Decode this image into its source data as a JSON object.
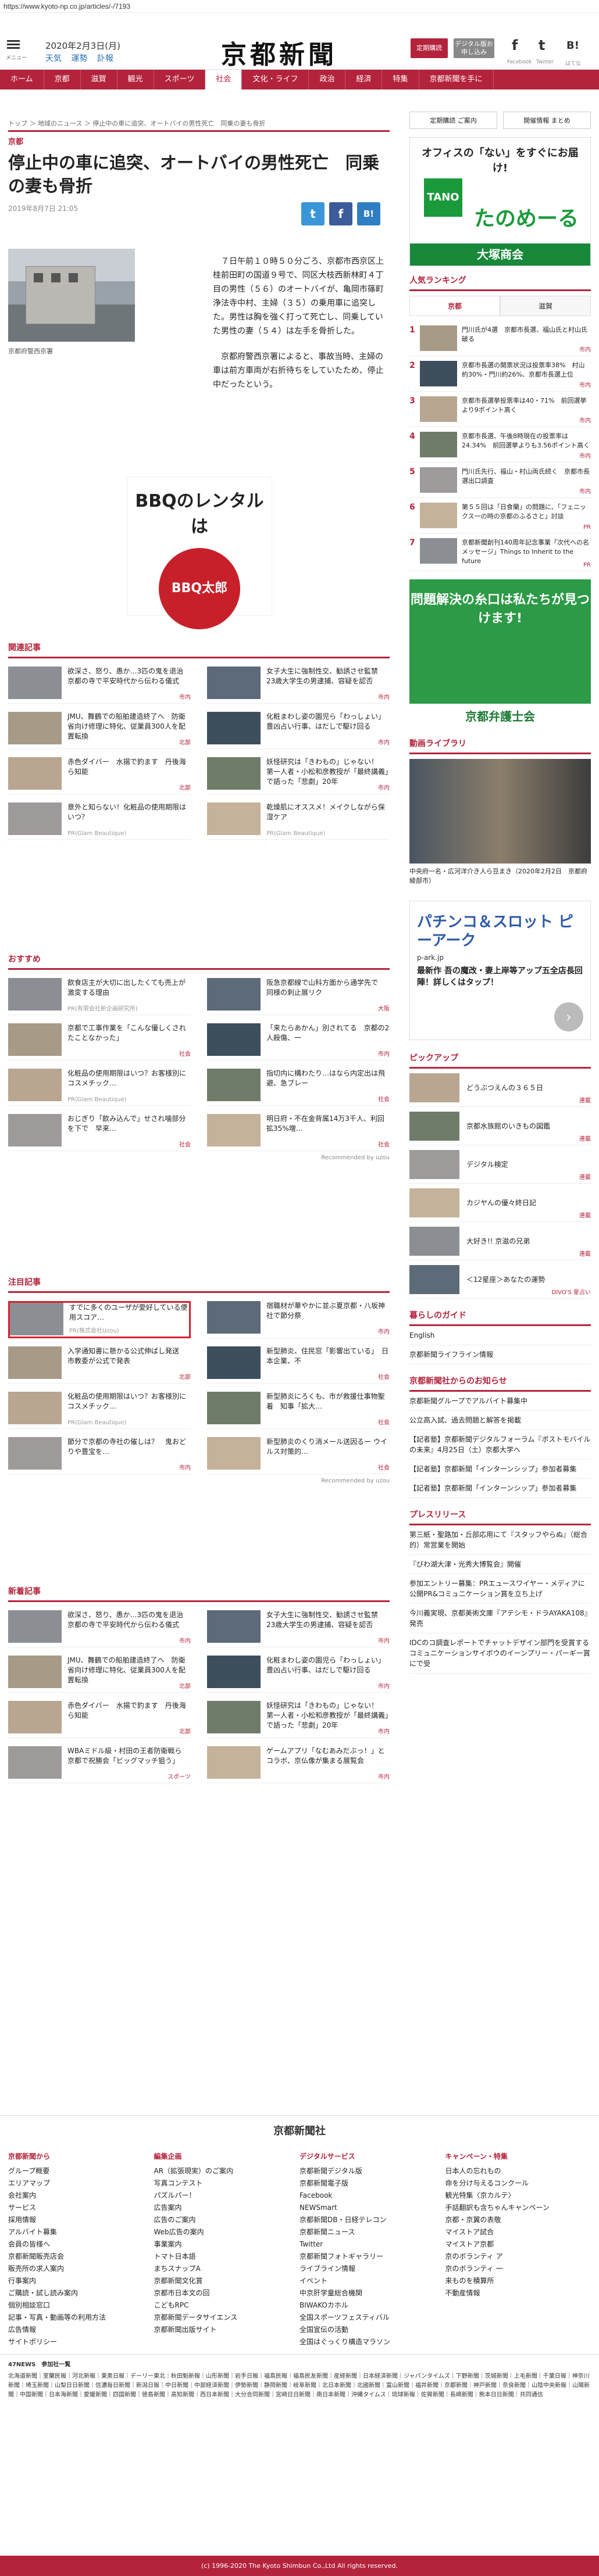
{
  "url": "https://www.kyoto-np.co.jp/articles/-/7193",
  "header": {
    "menu_label": "メニュー",
    "date": "2020年2月3日(月)",
    "weather": [
      "天気",
      "運勢",
      "訃報"
    ],
    "logo": "京都新聞",
    "subscribe_btn": "定期購読",
    "digital_btn": "デジタル版お申し込み",
    "social": [
      {
        "name": "facebook-icon",
        "glyph": "f",
        "label": "Facebook"
      },
      {
        "name": "twitter-icon",
        "glyph": "t",
        "label": "Twitter"
      },
      {
        "name": "hatena-icon",
        "glyph": "B!",
        "label": "はてな"
      }
    ]
  },
  "nav": [
    "ホーム",
    "京都",
    "滋賀",
    "観光",
    "スポーツ",
    "社会",
    "文化・ライフ",
    "政治",
    "経済",
    "特集",
    "京都新聞を手に"
  ],
  "nav_active": 5,
  "breadcrumb": "トップ ＞ 地域のニュース ＞ 停止中の車に追突、オートバイの男性死亡　同乗の妻も骨折",
  "article": {
    "section": "京都",
    "title": "停止中の車に追突、オートバイの男性死亡　同乗の妻も骨折",
    "date": "2019年8月7日 21:05",
    "caption": "京都府警西京署",
    "body": [
      "７日午前１０時５０分ごろ、京都市西京区上桂前田町の国道９号で、同区大枝西新林町４丁目の男性（５６）のオートバイが、亀岡市篠町浄法寺中村、主婦（３５）の乗用車に追突した。男性は胸を強く打って死亡し、同乗していた男性の妻（５４）は左手を骨折した。",
      "京都府警西京署によると、事故当時、主婦の車は前方車両が右折待ちをしていたため、停止中だったという。"
    ]
  },
  "ad_bbq": {
    "title": "BBQのレンタルは",
    "brand": "BBQ太郎"
  },
  "sections": {
    "related": {
      "title": "関連記事",
      "items": [
        {
          "text": "欲深さ、怒り、愚か…3匹の鬼を退治　京都の寺で平安時代から伝わる儀式",
          "tag": "市内"
        },
        {
          "text": "女子大生に強制性交、勧誘させ監禁　23歳大学生の男逮捕、容疑を認否",
          "tag": "市内"
        },
        {
          "text": "JMU、舞鶴での船舶建造終了へ　防衛省向け修理に特化、従業員300人を配置転換",
          "tag": "北部"
        },
        {
          "text": "化粧まわし姿の園児ら「わっしょい」　豊凶占い行事、はだしで駆け回る",
          "tag": "市内"
        },
        {
          "text": "赤色ダイバー　水揚で釣ます　丹後海ら知能",
          "tag": "北部"
        },
        {
          "text": "妖怪研究は「きわもの」じゃない！　第一人者・小松和彦教授が「最終講義」で語った「悲劇」20年",
          "tag": "市内"
        },
        {
          "text": "意外と知らない！化粧品の使用期限はいつ？",
          "pr": "PR(Glam Beautique)"
        },
        {
          "text": "乾燥肌にオススメ！メイクしながら保湿ケア",
          "pr": "PR(Glam Beautique)"
        }
      ]
    },
    "recommend": {
      "title": "おすすめ",
      "items": [
        {
          "text": "飲食店主が大切に出したくても売上が激変する理由",
          "pr": "PR(有限会社新企画研究所)"
        },
        {
          "text": "阪急京都線で山科方面から通学先で　同様の刺止展リク",
          "tag": "大阪"
        },
        {
          "text": "京都で工事作業を「こんな優しくされたことなかった」",
          "tag": "社会"
        },
        {
          "text": "「来たらあかん」別されてる　京都の2人殺傷、一",
          "tag": "市内"
        },
        {
          "text": "化粧品の使用期限はいつ？お客様別にコスメチック…",
          "pr": "PR(Glam Beautique)"
        },
        {
          "text": "指切内に構わたり…はなら内定出は飛避、急ブレー",
          "tag": "社会"
        },
        {
          "text": "おじぎり「飲み込んで」せされ噛部分を下で　早来…",
          "tag": "社会"
        },
        {
          "text": "明日府・不在金背属14万3千人、利回拡35%増…",
          "tag": "社会"
        }
      ],
      "credit": "Recommended by uzou"
    },
    "attention": {
      "title": "注目記事",
      "items": [
        {
          "text": "すでに多くのユーザが愛好している便用スコア…",
          "pr": "PR(株式会社Uzou)"
        },
        {
          "text": "宿職材が華やかに並ぶ夏京都・八坂神社で節分祭",
          "tag": "市内"
        },
        {
          "text": "入学通知書に懸かる公式伸ばし発送　市教委が公式で発表",
          "tag": "北部"
        },
        {
          "text": "新型肺炎、住民窓「影響出ている」　日本企業、不",
          "tag": "社会"
        },
        {
          "text": "化粧品の使用期限はいつ？お客様別にコスメチック…",
          "pr": "PR(Glam Beautique)"
        },
        {
          "text": "新型肺炎にろくも、市が救援仕事物聖着　知事「拡大…",
          "tag": "社会"
        },
        {
          "text": "節分で京都の寺社の催しは？　鬼おどりや豊宝を…",
          "tag": "市内"
        },
        {
          "text": "新型肺炎のくり消メール送因るー ウイルス対策的…",
          "tag": "社会"
        }
      ],
      "credit": "Recommended by uzou"
    },
    "latest": {
      "title": "新着記事",
      "items": [
        {
          "text": "欲深さ、怒り、愚か…3匹の鬼を退治　京都の寺で平安時代から伝わる儀式",
          "tag": "市内"
        },
        {
          "text": "女子大生に強制性交、勧誘させ監禁　23歳大学生の男逮捕、容疑を認否",
          "tag": "市内"
        },
        {
          "text": "JMU、舞鶴での船舶建造終了へ　防衛省向け修理に特化、従業員300人を配置転換",
          "tag": "北部"
        },
        {
          "text": "化粧まわし姿の園児ら「わっしょい」　豊凶占い行事、はだしで駆け回る",
          "tag": "市内"
        },
        {
          "text": "赤色ダイバー　水揚で釣ます　丹後海ら知能",
          "tag": "北部"
        },
        {
          "text": "妖怪研究は「きわもの」じゃない！　第一人者・小松和彦教授が「最終講義」で語った「悲劇」20年",
          "tag": "市内"
        },
        {
          "text": "WBAミドル級・村田の王者防衛戦ら　京都で祝勝会「ビッグマッチ狙う」",
          "tag": "スポーツ"
        },
        {
          "text": "ゲームアプリ「なむあみだぶっ！」とコラボ、京仏像が集まる展覧会",
          "tag": "市内"
        }
      ]
    }
  },
  "side": {
    "top_links": [
      "定期購読 ご案内",
      "開催情報 まとめ"
    ],
    "ad_tano": {
      "line1": "オフィスの「ない」をすぐにお届け!",
      "logo": "TANO",
      "brand": "たのめーる",
      "bar": "大塚商会"
    },
    "ranking": {
      "title": "人気ランキング",
      "tabs": [
        "京都",
        "滋賀"
      ],
      "items": [
        {
          "n": "1",
          "text": "門川氏が4選　京都市長選、福山氏と村山氏破る",
          "tag": "市内"
        },
        {
          "n": "2",
          "text": "京都市長選の開票状況は投票率38%　村山約30%・門川約26%、京都市長選上位",
          "tag": "市内"
        },
        {
          "n": "3",
          "text": "京都市長選挙投票率は40・71%　前回選挙より9ポイント高く",
          "tag": "市内"
        },
        {
          "n": "4",
          "text": "京都市長選、午後8時現在の投票率は24.34%　前回選挙よりも3.56ポイント高く",
          "tag": "市内"
        },
        {
          "n": "5",
          "text": "門川氏先行、福山・村山両氏続く　京都市長選出口調査",
          "tag": "市内"
        },
        {
          "n": "6",
          "text": "第５５回は「日食蘭」の問題に、「フェニックス一の時の京都のふるさと」討談",
          "tag": "PR"
        },
        {
          "n": "7",
          "text": "京都新聞創刊140周年記念事業「次代への名メッセージ」Things to Inherit to the future",
          "tag": "PR"
        }
      ]
    },
    "ad_green": {
      "line1": "問題解決の糸口は私たちが見つけます!",
      "bar": "京都弁護士会"
    },
    "video": {
      "title": "動画ライブラリ",
      "caption": "中央府一名・広河洋介き人ら豆まき（2020年2月2日　京都府綾部市）",
      "tag": "北部"
    },
    "ad_pachi": {
      "line1": "パチンコ＆スロット ピーアーク",
      "line2": "p-ark.jp",
      "line3": "最新作 吾の魔改・妻上岸等アップ五全店長回陣！詳しくはタップ！"
    },
    "pickup": {
      "title": "ピックアップ",
      "items": [
        {
          "text": "どうぶつえんの３６５日",
          "tag": "連載"
        },
        {
          "text": "京都水族館のいきもの図鑑",
          "tag": "連載"
        },
        {
          "text": "デジタル検定",
          "tag": "連載"
        },
        {
          "text": "カジヤんの優々終日記",
          "tag": "連載"
        },
        {
          "text": "大好き!! 京滋の兄弟",
          "tag": "連載"
        },
        {
          "text": "＜12星座＞あなたの運勢",
          "tag": "DIVO'S 星占い"
        }
      ]
    },
    "guide": {
      "title": "暮らしのガイド",
      "items": [
        "English",
        "京都新聞ライフライン情報"
      ]
    },
    "group": {
      "title": "京都新聞社からのお知らせ",
      "items": [
        "京都新聞グループでアルバイト募集中",
        "公立高入試、過去問題と解答を掲載",
        "【記者塾】京都新聞デジタルフォーラム『ポストモバイルの未来』4月25日（土）京都大学へ",
        "【記者塾】京都新聞「インターンシップ」参加者募集",
        "【記者塾】京都新聞「インターンシップ」参加者募集"
      ]
    },
    "press": {
      "title": "プレスリリース",
      "items": [
        "第三紙・聖路加・丘部応用にて『スタッフやらぬ』（総合的）常営業を開始",
        "『びわ湖大津・光秀大博覧会』開催",
        "参加エントリー募集：PRエュースワイヤー・メディアに公開PR&コミュニケーション賞を立ち上げ",
        "今川義実現、京都美術文庫『アテシモ・ドラAYAKA108』発売",
        "IDCのコ調査レポートでチャットデザイン部門を受賞するコミュニケーションサイボウのイーンプリー・パーギー賞にで受"
      ]
    }
  },
  "footer": {
    "brand": "京都新聞社",
    "cols": [
      {
        "h": "京都新聞から",
        "items": [
          "グループ概要",
          "エリアマップ",
          "会社案内",
          "サービス",
          "採用情報",
          "アルバイト募集",
          "会員の皆様へ",
          "京都新聞販売店会",
          "販売所の求人案内",
          "行事案内",
          "ご購読・試し読み案内",
          "個別相談窓口",
          "記事・写真・動画等の利用方法",
          "広告情報",
          "サイトポリシー"
        ]
      },
      {
        "h": "編集企画",
        "items": [
          "AR（拡張現実）のご案内",
          "写真コンテスト",
          "パズルパー！",
          "広告案内",
          "広告のご案内",
          "Web広告の案内",
          "事業案内",
          "トマト日本語",
          "まちスナップA",
          "京都新聞文化賞",
          "京都市日本文の回",
          "こどもRPC",
          "京都新聞データサイエンス",
          "京都新聞出版サイト"
        ]
      },
      {
        "h": "デジタルサービス",
        "items": [
          "京都新聞デジタル版",
          "京都新聞電子版",
          "Facebook",
          "NEWSmart",
          "京都新聞DB・日経テレコン",
          "京都新聞ニュース",
          "Twitter",
          "京都新聞フォトギャラリー",
          "ライブライン情報",
          "イベント",
          "中京肝学童総合機関",
          "BIWAKOカホル",
          "全国スポーツフェスティバル",
          "全国宣伝の活動",
          "全国はぐっくり構造マラソン"
        ]
      },
      {
        "h": "キャンペーン・特集",
        "items": [
          "日本人の忘れもの",
          "命を分け与えるコンクール",
          "観光特集〈京カルテ〉",
          "手話翻訳も含ちゃんキャンペーン",
          "京都・京翼の表敬",
          "マイストア試合",
          "マイストア京都",
          "京のボランティ ア",
          "京のボランティ 一",
          "来ものを積算所",
          "不動産情報"
        ]
      }
    ],
    "news47_title": "47NEWS　参加社一覧",
    "news47": "北海道新聞｜室蘭民報｜河北新報｜東奥日報｜デーリー東北｜秋田魁新報｜山形新聞｜岩手日報｜福島民報｜福島民友新聞｜産経新聞｜日本経済新聞｜ジャパンタイムズ｜下野新聞｜茨城新聞｜上毛新聞｜千葉日報｜神奈川新聞｜埼玉新聞｜山梨日日新聞｜信濃毎日新聞｜新潟日報｜中日新聞｜中部経済新聞｜伊勢新聞｜静岡新聞｜岐阜新聞｜北日本新聞｜北國新聞｜富山新聞｜福井新聞｜京都新聞｜神戸新聞｜奈良新聞｜山陰中央新報｜山陽新聞｜中国新聞｜日本海新聞｜愛媛新聞｜四国新聞｜徳島新聞｜高知新聞｜西日本新聞｜大分合同新聞｜宮崎日日新聞｜南日本新聞｜沖縄タイムス｜琉球新報｜佐賀新聞｜長崎新聞｜熊本日日新聞｜共同通信",
    "copyright": "(c) 1996-2020 The Kyoto Shimbun Co.,Ltd All rights reserved."
  }
}
